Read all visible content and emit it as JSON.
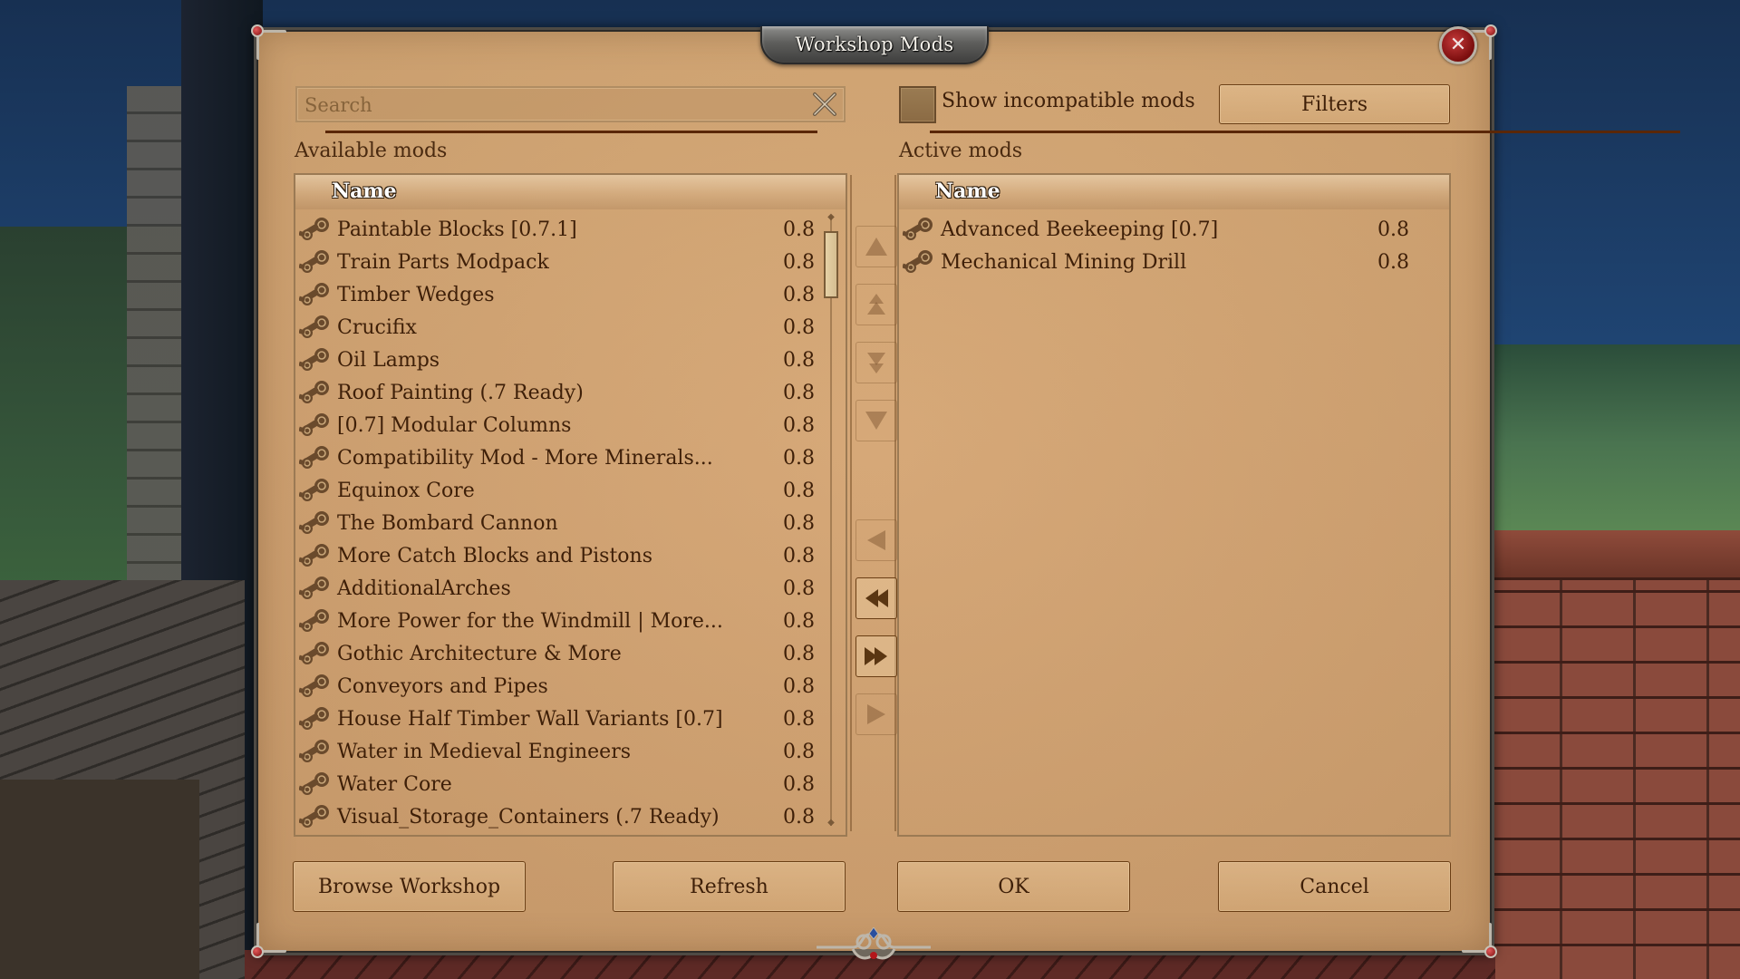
{
  "dialog": {
    "title": "Workshop Mods",
    "close_icon": "close-icon"
  },
  "search": {
    "placeholder": "Search",
    "value": "",
    "clear_icon": "clear-x-icon"
  },
  "show_incompatible": {
    "label": "Show incompatible mods",
    "checked": false
  },
  "filters_label": "Filters",
  "available": {
    "title": "Available mods",
    "column_header": "Name",
    "row_icon": "steam-icon",
    "items": [
      {
        "name": "Paintable Blocks [0.7.1]",
        "version": "0.8"
      },
      {
        "name": "Train Parts Modpack",
        "version": "0.8"
      },
      {
        "name": "Timber Wedges",
        "version": "0.8"
      },
      {
        "name": "Crucifix",
        "version": "0.8"
      },
      {
        "name": "Oil Lamps",
        "version": "0.8"
      },
      {
        "name": "Roof Painting (.7 Ready)",
        "version": "0.8"
      },
      {
        "name": "[0.7] Modular Columns",
        "version": "0.8"
      },
      {
        "name": "Compatibility Mod - More Minerals...",
        "version": "0.8"
      },
      {
        "name": "Equinox Core",
        "version": "0.8"
      },
      {
        "name": "The Bombard Cannon",
        "version": "0.8"
      },
      {
        "name": "More Catch Blocks and Pistons",
        "version": "0.8"
      },
      {
        "name": "AdditionalArches",
        "version": "0.8"
      },
      {
        "name": "More Power for the Windmill | More...",
        "version": "0.8"
      },
      {
        "name": "Gothic Architecture & More",
        "version": "0.8"
      },
      {
        "name": "Conveyors and Pipes",
        "version": "0.8"
      },
      {
        "name": "House Half Timber Wall Variants [0.7]",
        "version": "0.8"
      },
      {
        "name": "Water in Medieval Engineers",
        "version": "0.8"
      },
      {
        "name": "Water Core",
        "version": "0.8"
      },
      {
        "name": "Visual_Storage_Containers (.7 Ready)",
        "version": "0.8"
      }
    ],
    "scroll_position": 0
  },
  "active": {
    "title": "Active mods",
    "column_header": "Name",
    "row_icon": "steam-icon",
    "items": [
      {
        "name": "Advanced Beekeeping [0.7]",
        "version": "0.8"
      },
      {
        "name": "Mechanical Mining Drill",
        "version": "0.8"
      }
    ]
  },
  "order_buttons": [
    {
      "name": "move-to-top-button",
      "icon": "triangle-up-icon",
      "enabled": false
    },
    {
      "name": "move-up-button",
      "icon": "double-up-icon",
      "enabled": false
    },
    {
      "name": "move-down-button",
      "icon": "double-down-icon",
      "enabled": false
    },
    {
      "name": "move-to-bottom-button",
      "icon": "triangle-down-icon",
      "enabled": false
    },
    {
      "name": "remove-one-button",
      "icon": "triangle-left-icon",
      "enabled": false
    },
    {
      "name": "remove-all-button",
      "icon": "double-left-icon",
      "enabled": true
    },
    {
      "name": "add-all-button",
      "icon": "double-right-icon",
      "enabled": true
    },
    {
      "name": "add-one-button",
      "icon": "triangle-right-icon",
      "enabled": false
    }
  ],
  "footer": {
    "browse_label": "Browse Workshop",
    "refresh_label": "Refresh",
    "ok_label": "OK",
    "cancel_label": "Cancel"
  }
}
